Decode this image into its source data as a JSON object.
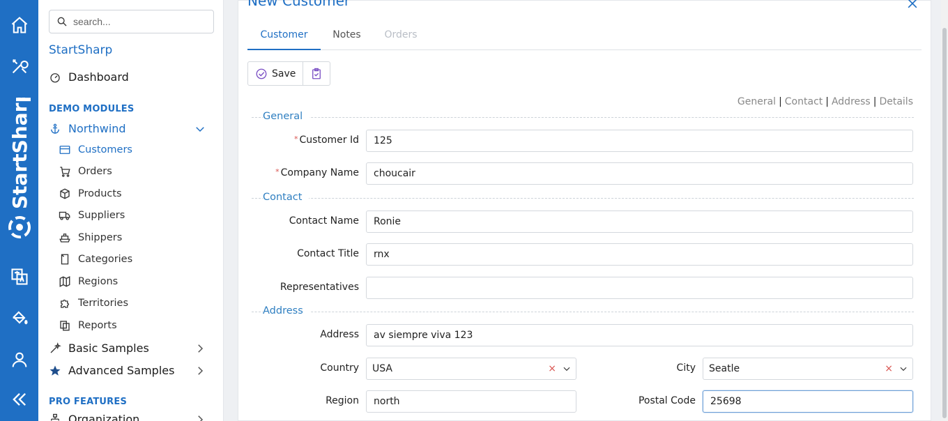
{
  "rail": {
    "brand_text": "StartSharp",
    "icons": [
      "home-icon",
      "tools-icon",
      "translate-icon",
      "paint-bucket-icon",
      "user-icon",
      "collapse-icon"
    ]
  },
  "sidebar": {
    "search_placeholder": "search...",
    "title": "StartSharp",
    "dashboard": "Dashboard",
    "demo_modules": "DEMO MODULES",
    "northwind": "Northwind",
    "items": [
      {
        "label": "Customers",
        "icon": "card-icon",
        "active": true
      },
      {
        "label": "Orders",
        "icon": "cart-icon"
      },
      {
        "label": "Products",
        "icon": "box-icon"
      },
      {
        "label": "Suppliers",
        "icon": "truck-icon"
      },
      {
        "label": "Shippers",
        "icon": "ship-icon"
      },
      {
        "label": "Categories",
        "icon": "bookmark-icon"
      },
      {
        "label": "Regions",
        "icon": "map-icon"
      },
      {
        "label": "Territories",
        "icon": "puzzle-icon"
      },
      {
        "label": "Reports",
        "icon": "copy-icon"
      }
    ],
    "basic_samples": "Basic Samples",
    "advanced_samples": "Advanced Samples",
    "pro_features": "PRO FEATURES",
    "organization": "Organization"
  },
  "dialog": {
    "title": "New Customer",
    "tabs": [
      "Customer",
      "Notes",
      "Orders"
    ],
    "save_label": "Save",
    "quicklinks": [
      "General",
      "Contact",
      "Address",
      "Details"
    ],
    "categories": {
      "general": "General",
      "contact": "Contact",
      "address": "Address"
    },
    "fields": {
      "customer_id": {
        "label": "Customer Id",
        "value": "125",
        "required": true
      },
      "company_name": {
        "label": "Company Name",
        "value": "choucair",
        "required": true
      },
      "contact_name": {
        "label": "Contact Name",
        "value": "Ronie"
      },
      "contact_title": {
        "label": "Contact Title",
        "value": "rnx"
      },
      "representatives": {
        "label": "Representatives",
        "value": ""
      },
      "address": {
        "label": "Address",
        "value": "av siempre viva 123"
      },
      "country": {
        "label": "Country",
        "value": "USA"
      },
      "city": {
        "label": "City",
        "value": "Seatle"
      },
      "region": {
        "label": "Region",
        "value": "north"
      },
      "postal_code": {
        "label": "Postal Code",
        "value": "25698"
      }
    },
    "required_mark": "*",
    "clear_mark": "×",
    "separator": "|"
  }
}
